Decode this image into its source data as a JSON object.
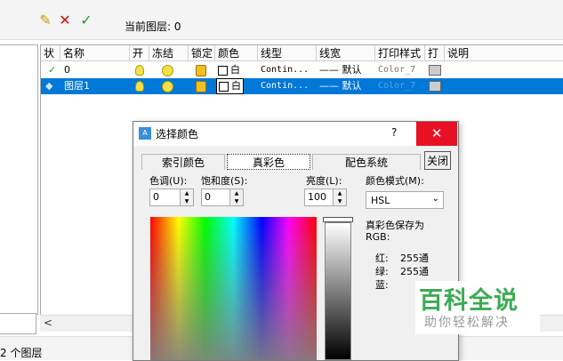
{
  "toolbar": {
    "icons": [
      "new-layer-icon",
      "delete-layer-icon",
      "set-current-icon"
    ],
    "current_layer_label": "当前图层: 0"
  },
  "grid": {
    "columns": [
      "状",
      "名称",
      "开",
      "冻结",
      "锁定",
      "颜色",
      "线型",
      "线宽",
      "打印样式",
      "打",
      "说明"
    ],
    "rows": [
      {
        "status": "✓",
        "name": "0",
        "color": "白",
        "linetype": "Contin...",
        "lineweight": "—— 默认",
        "plotstyle": "Color_7",
        "selected": false
      },
      {
        "status": "",
        "name": "图层1",
        "color": "白",
        "linetype": "Contin...",
        "lineweight": "—— 默认",
        "plotstyle": "Color_7",
        "selected": true
      }
    ]
  },
  "status": {
    "text": "2 个图层"
  },
  "dialog": {
    "title": "选择颜色",
    "help": "?",
    "close": "✕",
    "tabs": [
      "索引颜色",
      "真彩色",
      "配色系统"
    ],
    "active_tab": "真彩色",
    "close_button": "关闭",
    "hue_label": "色调(U):",
    "hue_value": "0",
    "saturation_label": "饱和度(S):",
    "saturation_value": "0",
    "luminance_label": "亮度(L):",
    "luminance_value": "100",
    "colormode_label": "颜色模式(M):",
    "colormode_value": "HSL",
    "truecolor_label": "真彩色保存为",
    "rgb_label": "RGB:",
    "red_label": "红:",
    "red_value": "255通",
    "green_label": "绿:",
    "green_value": "255通",
    "blue_label": "蓝:"
  },
  "watermark": {
    "title": "百科全说",
    "subtitle": "助你轻松解决"
  }
}
